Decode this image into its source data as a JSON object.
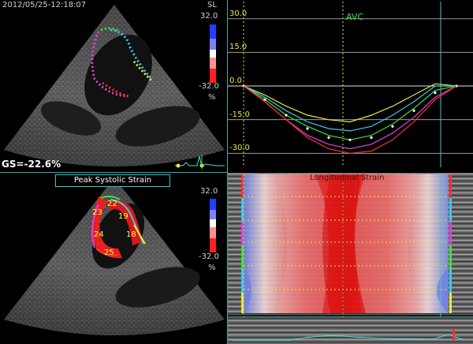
{
  "top_left": {
    "timestamp": "2012/05/25-12:18:07",
    "mode_label": "SL",
    "scale_max": "32.0",
    "scale_min": "-32.0",
    "unit": "%",
    "gs_value": "GS=-22.6%",
    "colors": {
      "trace_magenta": "#e040e0",
      "trace_cyan": "#40c8e8",
      "trace_yellow": "#e8e840",
      "trace_red": "#ff3030",
      "trace_green": "#40e040"
    }
  },
  "bottom_left": {
    "title": "Peak Systolic Strain",
    "scale_max": "32.0",
    "scale_min": "-32.0",
    "unit": "%",
    "segments": [
      {
        "label": "22"
      },
      {
        "label": "23"
      },
      {
        "label": "19"
      },
      {
        "label": "24"
      },
      {
        "label": "18"
      },
      {
        "label": "25"
      }
    ]
  },
  "chart": {
    "marker_label": "AVC",
    "ylabels": [
      "30.0",
      "15.0",
      "0.0",
      "-15.0",
      "-30.0"
    ]
  },
  "chart_data": {
    "type": "line",
    "title": "",
    "xlabel": "",
    "ylabel": "",
    "ylim": [
      -32,
      32
    ],
    "x": [
      0,
      10,
      20,
      30,
      40,
      50,
      60,
      70,
      80,
      90,
      100
    ],
    "series": [
      {
        "color": "#e8e840",
        "values": [
          0,
          -4,
          -9,
          -13,
          -15,
          -16,
          -13,
          -9,
          -4,
          1,
          0
        ]
      },
      {
        "color": "#40c8e8",
        "values": [
          0,
          -5,
          -11,
          -16,
          -19,
          -20,
          -18,
          -13,
          -7,
          0,
          0
        ]
      },
      {
        "color": "#40e040",
        "values": [
          0,
          -6,
          -13,
          -18,
          -22,
          -24,
          -22,
          -17,
          -10,
          -2,
          0
        ]
      },
      {
        "color": "#ffffff",
        "values": [
          0,
          -6,
          -13,
          -19,
          -23,
          -24,
          -23,
          -18,
          -11,
          -3,
          0
        ]
      },
      {
        "color": "#e040e0",
        "values": [
          0,
          -7,
          -15,
          -22,
          -26,
          -28,
          -26,
          -21,
          -14,
          -5,
          0
        ]
      },
      {
        "color": "#ff3030",
        "values": [
          0,
          -7,
          -15,
          -23,
          -28,
          -30,
          -29,
          -24,
          -16,
          -6,
          0
        ]
      }
    ]
  },
  "heatmap": {
    "title": "Longitudinal Strain",
    "colors": {
      "high_neg": "#e01818",
      "mid": "#f0c8c8",
      "pos": "#7080e0"
    }
  }
}
